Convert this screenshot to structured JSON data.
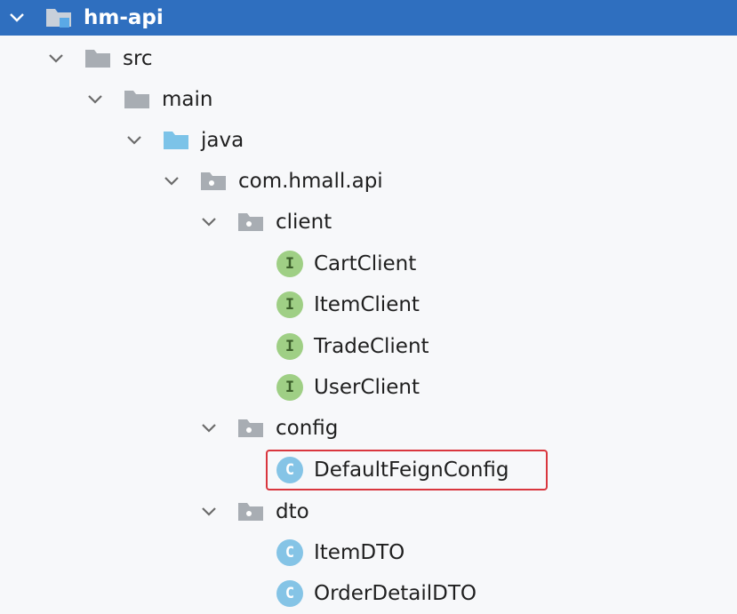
{
  "tree": {
    "root": {
      "label": "hm-api",
      "icon": "module-folder-icon"
    },
    "src": {
      "label": "src",
      "icon": "folder-icon"
    },
    "main": {
      "label": "main",
      "icon": "folder-icon"
    },
    "java": {
      "label": "java",
      "icon": "source-root-folder-icon"
    },
    "package": {
      "label": "com.hmall.api",
      "icon": "package-icon"
    },
    "client": {
      "label": "client",
      "icon": "package-icon",
      "children": [
        {
          "label": "CartClient",
          "kind": "interface",
          "badge": "I"
        },
        {
          "label": "ItemClient",
          "kind": "interface",
          "badge": "I"
        },
        {
          "label": "TradeClient",
          "kind": "interface",
          "badge": "I"
        },
        {
          "label": "UserClient",
          "kind": "interface",
          "badge": "I"
        }
      ]
    },
    "config": {
      "label": "config",
      "icon": "package-icon",
      "children": [
        {
          "label": "DefaultFeignConfig",
          "kind": "class",
          "badge": "C",
          "highlighted": true
        }
      ]
    },
    "dto": {
      "label": "dto",
      "icon": "package-icon",
      "children": [
        {
          "label": "ItemDTO",
          "kind": "class",
          "badge": "C"
        },
        {
          "label": "OrderDetailDTO",
          "kind": "class",
          "badge": "C"
        }
      ]
    }
  },
  "colors": {
    "selection": "#2f6fbf",
    "highlight_border": "#d9363e",
    "interface_badge": "#9fcf85",
    "class_badge": "#85c4e6"
  }
}
